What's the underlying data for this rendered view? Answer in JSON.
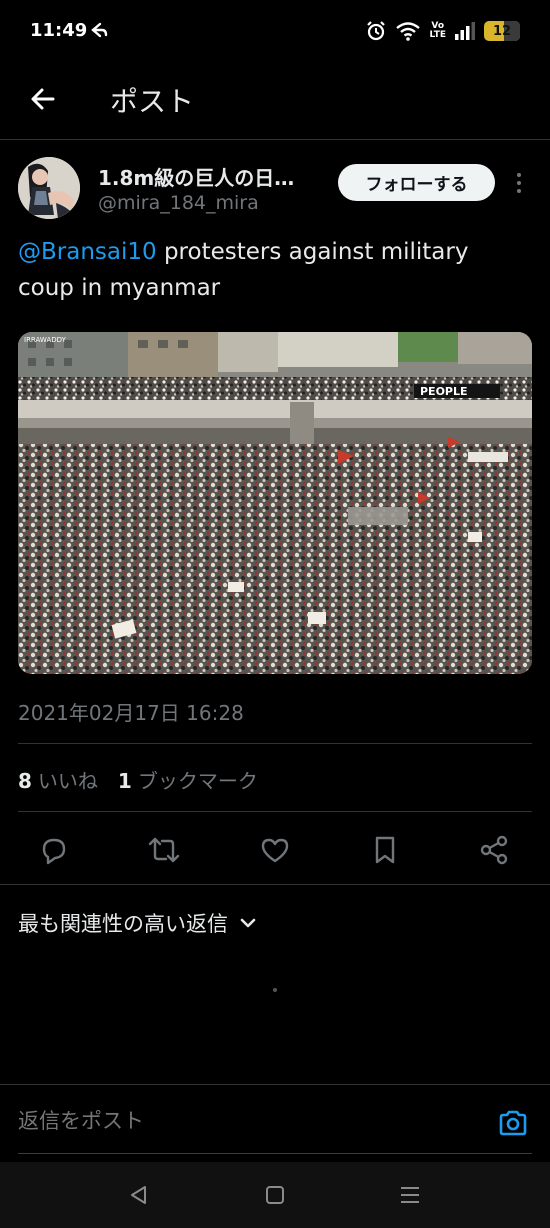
{
  "status_bar": {
    "time": "11:49",
    "volte_top": "Vo",
    "volte_bottom": "LTE",
    "battery": "12"
  },
  "header": {
    "title": "ポスト"
  },
  "post": {
    "author_name": "1.8m級の巨人の日…",
    "author_handle": "@mira_184_mira",
    "follow_label": "フォローする",
    "mention": "@Bransai10",
    "text": " protesters against military coup in myanmar",
    "image_watermark": "IRRAWADDY",
    "image_banner": "PEOPLE",
    "timestamp": "2021年02月17日 16:28",
    "likes_count": "8",
    "likes_label": "いいね",
    "bookmarks_count": "1",
    "bookmarks_label": "ブックマーク"
  },
  "replies": {
    "sort_label": "最も関連性の高い返信"
  },
  "reply_bar": {
    "placeholder": "返信をポスト"
  },
  "colors": {
    "accent": "#1d9bf0",
    "background": "#000000",
    "text_primary": "#e7e9ea",
    "text_secondary": "#71767b"
  }
}
